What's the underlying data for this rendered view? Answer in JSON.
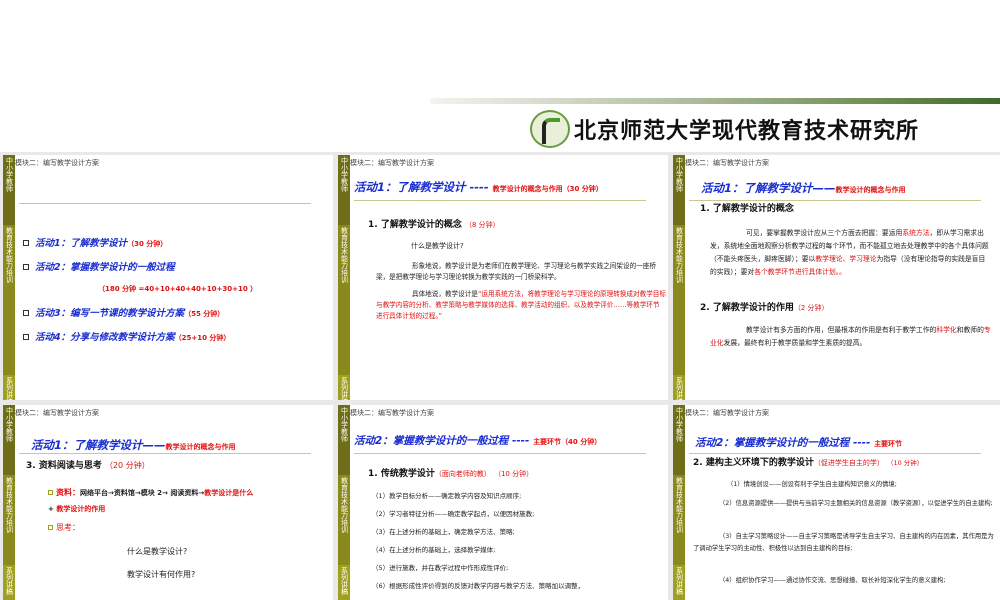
{
  "header": {
    "institute": "北京师范大学现代教育技术研究所"
  },
  "sidebar_text": {
    "top": "中小学教师",
    "middle": "教育技术能力培训",
    "bottom": "系列讲稿"
  },
  "module_label": "模块二：编写教学设计方案",
  "slide1": {
    "items": [
      {
        "label": "活动1：了解教学设计",
        "time": "（30 分钟）"
      },
      {
        "label": "活动2：掌握教学设计的一般过程",
        "time": ""
      },
      {
        "label": "活动3：编写一节课的教学设计方案",
        "time": "（55 分钟）"
      },
      {
        "label": "活动4：分享与修改教学设计方案",
        "time": "（25+10 分钟）"
      }
    ],
    "breakdown": "（180 分钟 =40+10+40+40+10+30+10 ）"
  },
  "slide2": {
    "title": "活动1：了解教学设计 ----",
    "subtitle": "教学设计的概念与作用（30 分钟）",
    "heading": "1. 了解教学设计的概念",
    "heading_time": "（8 分钟）",
    "question": "什么是教学设计?",
    "p1": "形象地说，教学设计是为老师们在教学理论、学习理论与教学实践之间架设的一座桥梁，是把教学理论与学习理论转换为教学实践的一门桥梁科学。",
    "p2_lead": "具体地说，教学设计是",
    "p2_quote": "“运用系统方法，将教学理论与学习理论的原理转换成对教学目标与教学内容的分析、教学策略与教学媒体的选择、教学活动的组织、以及教学评价……等教学环节进行具体计划的过程。”"
  },
  "slide3": {
    "title": "活动1：了解教学设计——",
    "subtitle": "教学设计的概念与作用",
    "heading1": "1. 了解教学设计的概念",
    "p1": [
      "可见，要掌握教学设计应从三个方面去把握：要运用",
      "系统方法",
      "，即从学习需求出发，系统地全面地观察分析教学过程的每个环节，而不能孤立地去处理教学中的各个具体问题（不能头疼医头，脚疼医脚）；要以",
      "教学理论、学习理论",
      "为指导（没有理论指导的实践是盲目的实践）；要对",
      "各个教学环节进行具体计划。。"
    ],
    "heading2": "2. 了解教学设计的作用",
    "heading2_time": "（2 分钟）",
    "p2": [
      "教学设计有多方面的作用，但最根本的作用是有利于教学工作的",
      "科学化",
      "和教师的",
      "专业化",
      "发展，最终有利于教学质量和学生素质的提高。"
    ]
  },
  "slide4": {
    "title": "活动1：了解教学设计——",
    "subtitle": "教学设计的概念与作用",
    "heading": "3.  资料阅读与思考",
    "heading_time": "（20 分钟）",
    "material_label": "资料：",
    "material_path": "网络平台→资料馆→模块 2→ 阅读资料→",
    "material_red": "教学设计是什么",
    "material_plus": "+ ",
    "material_red2": "教学设计的作用",
    "think_label": "思考：",
    "q1": "什么是教学设计?",
    "q2": "教学设计有何作用?"
  },
  "slide5": {
    "title": "活动2：掌握教学设计的一般过程 ----",
    "subtitle": "主要环节（40 分钟）",
    "heading": "1.  传统教学设计",
    "heading_note": "（面向老师的教）",
    "heading_time": "（10 分钟）",
    "items": [
      "（1）教学目标分析——确定教学内容及知识点顺序;",
      "（2）学习者特征分析——确定教学起点，以便因材施教;",
      "（3）在上述分析的基础上，确定教学方法、策略;",
      "（4）在上述分析的基础上，选择教学媒体;",
      "（5）进行施教，并在教学过程中作形成性评价;",
      "（6）根据形成性评价得到的反馈对教学内容与教学方法、策略加以调整，"
    ]
  },
  "slide6": {
    "title": "活动2：掌握教学设计的一般过程 ----",
    "subtitle": "主要环节",
    "heading": "2. 建构主义环境下的教学设计",
    "heading_note": "（促进学生自主的学）",
    "heading_time": "（10 分钟）",
    "items": [
      "（1）情境创设——创设有利于学生自主建构知识意义的情境;",
      "（2）信息资源提供——提供与当前学习主题相关的信息资源（教学资源），以促进学生的自主建构;",
      "（3）自主学习策略设计——自主学习策略是诱导学生自主学习、自主建构的内在因素，其作用是为了调动学生学习的主动性、积极性以达到自主建构的目标;",
      "（4）组织协作学习——通过协作交流、思想碰撞、取长补短深化学生的意义建构;"
    ]
  }
}
